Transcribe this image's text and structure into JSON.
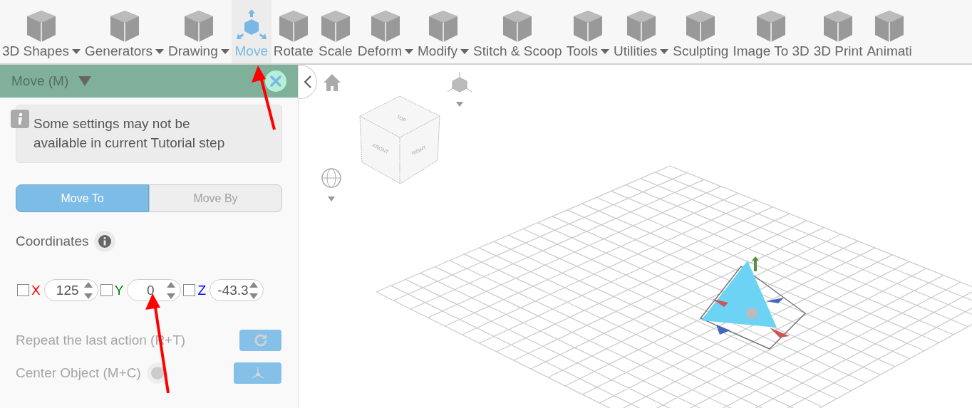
{
  "toolbar": {
    "items": [
      {
        "label": "3D Shapes",
        "dropdown": true,
        "selected": false
      },
      {
        "label": "Generators",
        "dropdown": true,
        "selected": false
      },
      {
        "label": "Drawing",
        "dropdown": true,
        "selected": false
      },
      {
        "label": "Move",
        "dropdown": false,
        "selected": true
      },
      {
        "label": "Rotate",
        "dropdown": false,
        "selected": false
      },
      {
        "label": "Scale",
        "dropdown": false,
        "selected": false
      },
      {
        "label": "Deform",
        "dropdown": true,
        "selected": false
      },
      {
        "label": "Modify",
        "dropdown": true,
        "selected": false
      },
      {
        "label": "Stitch & Scoop",
        "dropdown": false,
        "selected": false
      },
      {
        "label": "Tools",
        "dropdown": true,
        "selected": false
      },
      {
        "label": "Utilities",
        "dropdown": true,
        "selected": false
      },
      {
        "label": "Sculpting",
        "dropdown": false,
        "selected": false
      },
      {
        "label": "Image To 3D",
        "dropdown": false,
        "selected": false
      },
      {
        "label": "3D Print",
        "dropdown": false,
        "selected": false
      },
      {
        "label": "Animati",
        "dropdown": false,
        "selected": false
      }
    ]
  },
  "panel": {
    "title": "Move (M)",
    "notice": "Some settings may not be available in current Tutorial step",
    "modes": [
      {
        "label": "Move To",
        "selected": true
      },
      {
        "label": "Move By",
        "selected": false
      }
    ],
    "coordinates_label": "Coordinates",
    "axes": [
      {
        "label": "X",
        "color": "#ff0000",
        "value": "125",
        "checked": false
      },
      {
        "label": "Y",
        "color": "#008000",
        "value": "0",
        "checked": false
      },
      {
        "label": "Z",
        "color": "#0000ff",
        "value": "-43.3",
        "checked": false
      }
    ],
    "actions": [
      {
        "label": "Repeat the last action (R+T)",
        "kind": "repeat",
        "disabled": true
      },
      {
        "label": "Center Object (M+C)",
        "kind": "center",
        "disabled": true
      }
    ]
  },
  "viewport": {
    "view_cube": {
      "top": "TOP",
      "front": "FRONT",
      "right": "RIGHT"
    }
  }
}
